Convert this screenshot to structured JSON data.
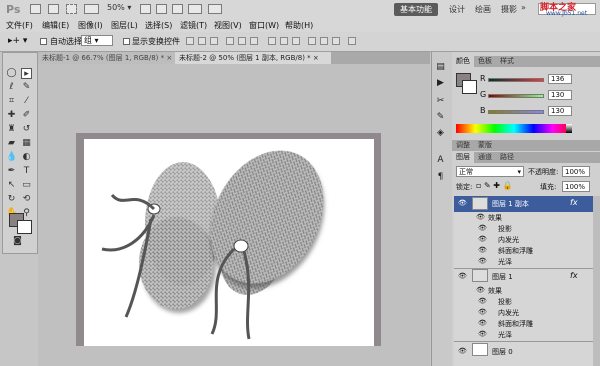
{
  "appbar": {
    "logo": "Ps",
    "zoom": "50%",
    "workspaces": [
      "基本功能",
      "设计",
      "绘画",
      "摄影"
    ],
    "watermark": "脚本之家",
    "watermark_url": "www.Jb51.net"
  },
  "menu": [
    "文件(F)",
    "编辑(E)",
    "图像(I)",
    "图层(L)",
    "选择(S)",
    "滤镜(T)",
    "视图(V)",
    "窗口(W)",
    "帮助(H)"
  ],
  "options": {
    "auto_select_label": "自动选择:",
    "auto_select_value": "组",
    "show_transform_label": "显示变换控件"
  },
  "tabs": [
    "未标题-1 @ 66.7% (图层 1, RGB/8) *",
    "未标题-2 @ 50% (图层 1 副本, RGB/8) *"
  ],
  "color_panel": {
    "tabs": [
      "颜色",
      "色板",
      "样式"
    ],
    "sliders": [
      {
        "label": "R",
        "value": "136",
        "color_from": "#003333",
        "color_to": "#ff3333"
      },
      {
        "label": "G",
        "value": "130",
        "color_from": "#880000",
        "color_to": "#88ff88"
      },
      {
        "label": "B",
        "value": "130",
        "color_from": "#888200",
        "color_to": "#8882ff"
      }
    ],
    "foreground": "#888282"
  },
  "adjust_tabs": [
    "调整",
    "蒙版"
  ],
  "layers_panel": {
    "tabs": [
      "图层",
      "通道",
      "路径"
    ],
    "blend_mode": "正常",
    "opacity_label": "不透明度:",
    "opacity": "100%",
    "lock_label": "锁定:",
    "fill_label": "填充:",
    "fill": "100%",
    "layers": [
      {
        "name": "图层 1 副本",
        "selected": true,
        "effects_label": "效果",
        "effects": [
          "投影",
          "内发光",
          "斜面和浮雕",
          "光泽"
        ]
      },
      {
        "name": "图层 1",
        "selected": false,
        "effects_label": "效果",
        "effects": [
          "投影",
          "内发光",
          "斜面和浮雕",
          "光泽"
        ]
      },
      {
        "name": "图层 0",
        "selected": false,
        "effects": []
      }
    ],
    "fx": "fx"
  }
}
